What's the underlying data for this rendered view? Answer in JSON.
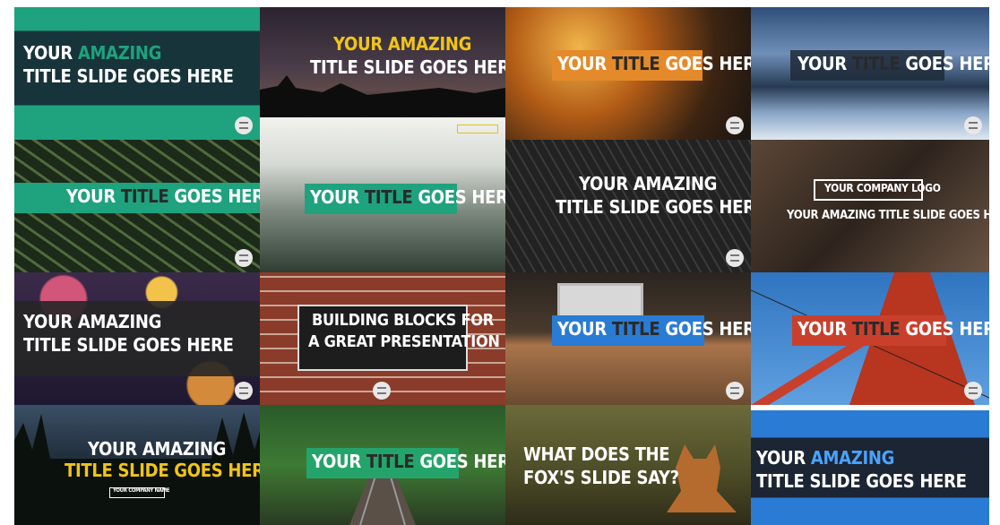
{
  "tiles": [
    {
      "line1a": "YOUR ",
      "line1b": "AMAZING",
      "line2": "TITLE SLIDE GOES HERE"
    },
    {
      "line1": "YOUR AMAZING",
      "line2": "TITLE SLIDE GOES HERE"
    },
    {
      "a": "YOUR ",
      "b": "TITLE",
      "c": " GOES HERE"
    },
    {
      "a": "YOUR ",
      "b": "TITLE",
      "c": " GOES HERE"
    },
    {
      "a": "YOUR ",
      "b": "TITLE",
      "c": " GOES HERE"
    },
    {
      "a": "YOUR ",
      "b": "TITLE",
      "c": " GOES HERE"
    },
    {
      "line1": "YOUR AMAZING",
      "line2": "TITLE SLIDE GOES HERE"
    },
    {
      "logo": "YOUR COMPANY LOGO",
      "line": "YOUR AMAZING TITLE SLIDE GOES HERE"
    },
    {
      "line1": "YOUR AMAZING",
      "line2": "TITLE SLIDE GOES HERE"
    },
    {
      "line1": "BUILDING BLOCKS FOR",
      "line2": "A GREAT PRESENTATION"
    },
    {
      "a": "YOUR ",
      "b": "TITLE",
      "c": " GOES HERE"
    },
    {
      "a": "YOUR ",
      "b": "TITLE",
      "c": " GOES HERE"
    },
    {
      "line1": "YOUR AMAZING",
      "line2": "TITLE SLIDE GOES HERE",
      "sub": "YOUR COMPANY NAME"
    },
    {
      "a": "YOUR ",
      "b": "TITLE",
      "c": " GOES HERE"
    },
    {
      "line1": "WHAT DOES THE",
      "line2": "FOX'S SLIDE SAY?"
    },
    {
      "line1a": "YOUR ",
      "line1b": "AMAZING",
      "line2": "TITLE SLIDE GOES HERE"
    }
  ],
  "colors": {
    "teal": "#1fa27e",
    "teal_dark": "#17343a",
    "orange": "#e48a2b",
    "yellow": "#f0c419",
    "blue": "#2a7bd4",
    "red": "#c8402c",
    "green": "#24a46a",
    "dark_band": "#262626"
  }
}
